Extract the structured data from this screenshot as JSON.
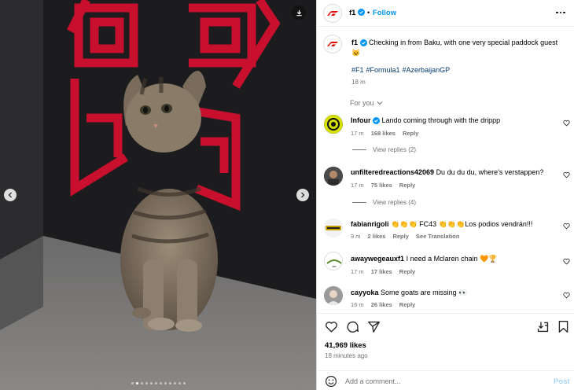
{
  "header": {
    "username": "f1",
    "separator": "•",
    "follow_label": "Follow"
  },
  "caption": {
    "username": "f1",
    "text": "Checking in from Baku, with one very special paddock guest",
    "emoji": "🐱",
    "hashtags": [
      "#F1",
      "#Formula1",
      "#AzerbaijanGP"
    ],
    "time": "18 m"
  },
  "for_you_label": "For you",
  "comments": [
    {
      "username": "Infour",
      "verified": true,
      "text": "Lando coming through with the drippp",
      "time": "17 m",
      "likes": "168 likes",
      "reply": "Reply",
      "view_replies": "View replies (2)"
    },
    {
      "username": "unfilteredreactions42069",
      "verified": false,
      "text": "Du du du du, where's verstappen?",
      "time": "17 m",
      "likes": "75 likes",
      "reply": "Reply",
      "view_replies": "View replies (4)"
    },
    {
      "username": "fabianrigoli",
      "verified": false,
      "text": "👏👏👏 FC43 👏👏👏Los podios vendrán!!!",
      "time": "9 m",
      "likes": "2 likes",
      "reply": "Reply",
      "extra": "See Translation"
    },
    {
      "username": "awaywegeauxf1",
      "verified": false,
      "text": "I need a Mclaren chain 🧡🏆",
      "time": "17 m",
      "likes": "17 likes",
      "reply": "Reply"
    },
    {
      "username": "cayyoka",
      "verified": false,
      "text": "Some goats are missing 👀",
      "time": "16 m",
      "likes": "26 likes",
      "reply": "Reply"
    }
  ],
  "post": {
    "likes": "41,969 likes",
    "time": "18 minutes ago"
  },
  "composer": {
    "placeholder": "Add a comment...",
    "post_label": "Post"
  },
  "carousel": {
    "slide_count": 12,
    "active_index": 1
  },
  "colors": {
    "accent": "#0095f6",
    "brand_red": "#e10600",
    "muted": "#737373"
  }
}
